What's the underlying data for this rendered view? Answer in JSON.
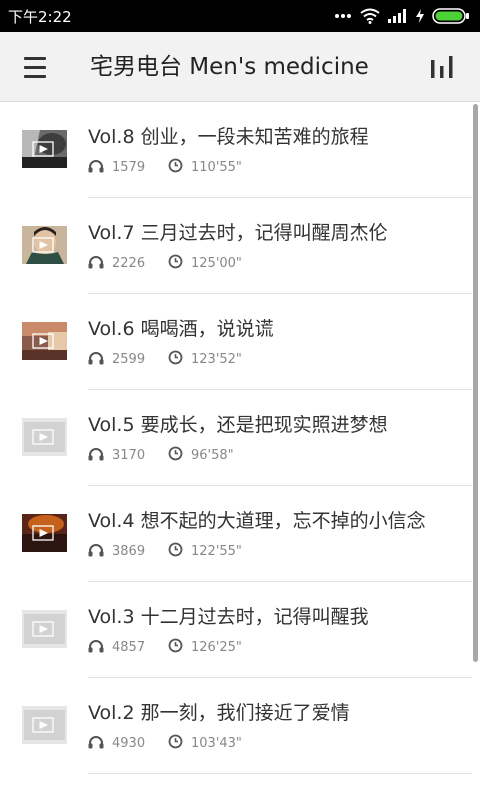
{
  "status_bar": {
    "time": "下午2:22",
    "dots": "..."
  },
  "header": {
    "title": "宅男电台 Men's medicine"
  },
  "episodes": [
    {
      "title": "Vol.8 创业，一段未知苦难的旅程",
      "plays": "1579",
      "duration": "110'55\""
    },
    {
      "title": "Vol.7 三月过去时，记得叫醒周杰伦",
      "plays": "2226",
      "duration": "125'00\""
    },
    {
      "title": "Vol.6 喝喝酒，说说谎",
      "plays": "2599",
      "duration": "123'52\""
    },
    {
      "title": "Vol.5 要成长，还是把现实照进梦想",
      "plays": "3170",
      "duration": "96'58\""
    },
    {
      "title": "Vol.4 想不起的大道理，忘不掉的小信念",
      "plays": "3869",
      "duration": "122'55\""
    },
    {
      "title": "Vol.3 十二月过去时，记得叫醒我",
      "plays": "4857",
      "duration": "126'25\""
    },
    {
      "title": "Vol.2 那一刻，我们接近了爱情",
      "plays": "4930",
      "duration": "103'43\""
    }
  ]
}
